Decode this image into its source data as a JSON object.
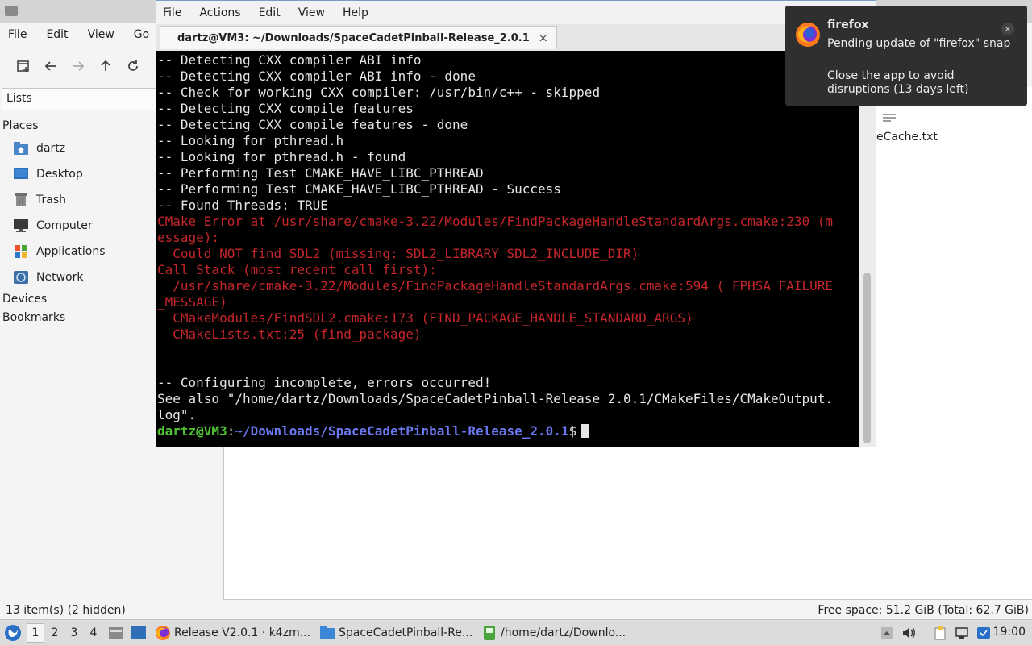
{
  "file_manager": {
    "menu": [
      "File",
      "Edit",
      "View",
      "Go"
    ],
    "sidebar_select": "Lists",
    "places_header": "Places",
    "places": [
      "dartz",
      "Desktop",
      "Trash",
      "Computer",
      "Applications",
      "Network"
    ],
    "devices_header": "Devices",
    "bookmarks_header": "Bookmarks",
    "visible_file": "eCache.txt",
    "status_left": "13 item(s) (2 hidden)",
    "status_right": "Free space: 51.2 GiB (Total: 62.7 GiB)"
  },
  "terminal": {
    "menu": [
      "File",
      "Actions",
      "Edit",
      "View",
      "Help"
    ],
    "tab_title": "dartz@VM3: ~/Downloads/SpaceCadetPinball-Release_2.0.1",
    "tab_close": "×",
    "lines": [
      {
        "text": "-- Detecting CXX compiler ABI info",
        "err": false
      },
      {
        "text": "-- Detecting CXX compiler ABI info - done",
        "err": false
      },
      {
        "text": "-- Check for working CXX compiler: /usr/bin/c++ - skipped",
        "err": false
      },
      {
        "text": "-- Detecting CXX compile features",
        "err": false
      },
      {
        "text": "-- Detecting CXX compile features - done",
        "err": false
      },
      {
        "text": "-- Looking for pthread.h",
        "err": false
      },
      {
        "text": "-- Looking for pthread.h - found",
        "err": false
      },
      {
        "text": "-- Performing Test CMAKE_HAVE_LIBC_PTHREAD",
        "err": false
      },
      {
        "text": "-- Performing Test CMAKE_HAVE_LIBC_PTHREAD - Success",
        "err": false
      },
      {
        "text": "-- Found Threads: TRUE",
        "err": false
      },
      {
        "text": "CMake Error at /usr/share/cmake-3.22/Modules/FindPackageHandleStandardArgs.cmake:230 (m",
        "err": true
      },
      {
        "text": "essage):",
        "err": true
      },
      {
        "text": "  Could NOT find SDL2 (missing: SDL2_LIBRARY SDL2_INCLUDE_DIR)",
        "err": true
      },
      {
        "text": "Call Stack (most recent call first):",
        "err": true
      },
      {
        "text": "  /usr/share/cmake-3.22/Modules/FindPackageHandleStandardArgs.cmake:594 (_FPHSA_FAILURE",
        "err": true
      },
      {
        "text": "_MESSAGE)",
        "err": true
      },
      {
        "text": "  CMakeModules/FindSDL2.cmake:173 (FIND_PACKAGE_HANDLE_STANDARD_ARGS)",
        "err": true
      },
      {
        "text": "  CMakeLists.txt:25 (find_package)",
        "err": true
      },
      {
        "text": "",
        "err": false
      },
      {
        "text": "",
        "err": false
      },
      {
        "text": "-- Configuring incomplete, errors occurred!",
        "err": false
      },
      {
        "text": "See also \"/home/dartz/Downloads/SpaceCadetPinball-Release_2.0.1/CMakeFiles/CMakeOutput.",
        "err": false
      },
      {
        "text": "log\".",
        "err": false
      }
    ],
    "prompt_user": "dartz@VM3",
    "prompt_sep": ":",
    "prompt_path": "~/Downloads/SpaceCadetPinball-Release_2.0.1",
    "prompt_end": "$"
  },
  "notification": {
    "title": "firefox",
    "line1": "Pending update of \"firefox\" snap",
    "line2": "Close the app to avoid disruptions (13 days left)",
    "close": "×"
  },
  "taskbar": {
    "workspaces": [
      "1",
      "2",
      "3",
      "4"
    ],
    "active_workspace": "1",
    "tasks": [
      "Release V2.0.1 · k4zm...",
      "SpaceCadetPinball-Re...",
      "/home/dartz/Downlo..."
    ],
    "clock": "19:00"
  },
  "colors": {
    "terminal_bg": "#000000",
    "error_text": "#c4262b",
    "prompt_user": "#4ec133",
    "prompt_path": "#6a78f0",
    "notification_bg": "#2f2f2f"
  }
}
